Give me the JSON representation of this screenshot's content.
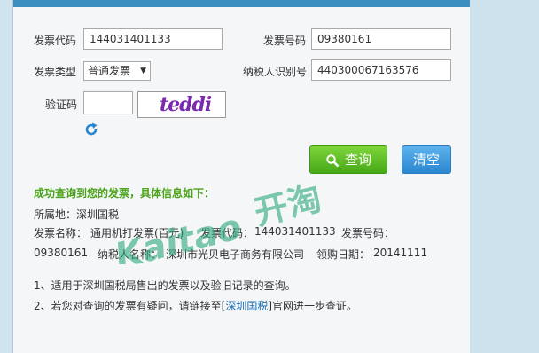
{
  "form": {
    "invoice_code_label": "发票代码",
    "invoice_code_value": "144031401133",
    "invoice_no_label": "发票号码",
    "invoice_no_value": "09380161",
    "invoice_type_label": "发票类型",
    "invoice_type_value": "普通发票",
    "taxpayer_id_label": "纳税人识别号",
    "taxpayer_id_value": "440300067163576",
    "captcha_label": "验证码",
    "captcha_value": "",
    "captcha_text": "teddi"
  },
  "buttons": {
    "query": "查询",
    "clear": "清空"
  },
  "result": {
    "success_msg": "成功查询到您的发票，具体信息如下：",
    "location_line": "所属地：深圳国税",
    "name_label": "发票名称：",
    "name_value": "通用机打发票(百元)",
    "code_label": "发票代码：",
    "code_value": "144031401133",
    "no_label": "发票号码：",
    "no_value": "09380161",
    "taxpayer_label": "纳税人名称：",
    "taxpayer_value": "深圳市光贝电子商务有限公司",
    "date_label": "领购日期：",
    "date_value": "20141111"
  },
  "notes": {
    "note1": "1、适用于深圳国税局售出的发票以及验旧记录的查询。",
    "note2_prefix": "2、若您对查询的发票有疑问，请链接至[",
    "note2_link": "深圳国税",
    "note2_suffix": "]官网进一步查证。"
  },
  "watermark": {
    "latin": "Kaitao",
    "cjk": "开淘"
  },
  "colors": {
    "accent_green": "#4aa31a",
    "button_green": "#45a918",
    "button_blue": "#2a86cf",
    "link": "#1a6fb5",
    "watermark": "#2aa87a"
  },
  "icons": [
    "refresh-icon",
    "search-icon",
    "dropdown-arrow-icon"
  ]
}
